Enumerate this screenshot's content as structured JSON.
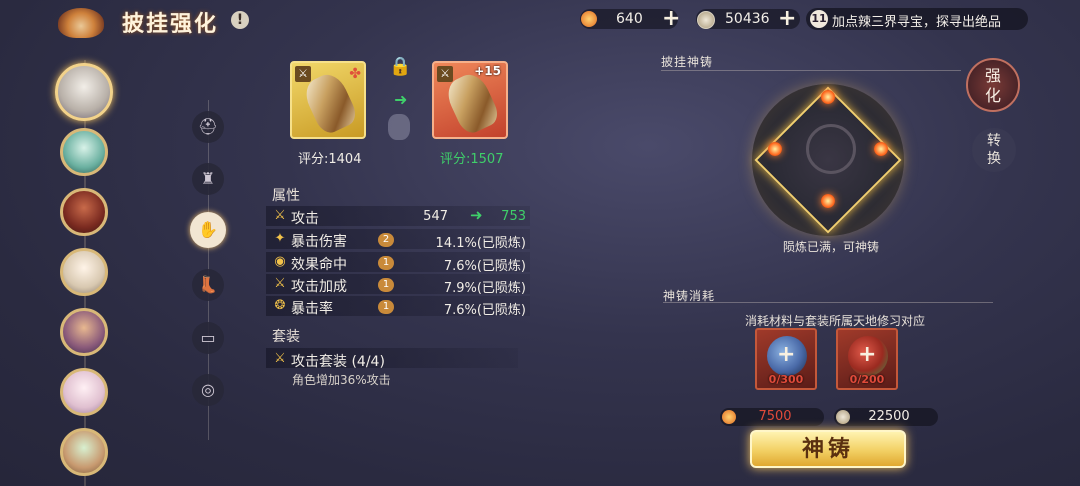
{
  "header": {
    "title": "披挂强化",
    "help_label": "!",
    "resource1": {
      "value": "640",
      "icon": "gold-ingot-icon",
      "plus": "+"
    },
    "resource2": {
      "value": "50436",
      "icon": "coin-icon",
      "plus": "+"
    },
    "hint_badge": "11",
    "hint_text": "加点辣三界寻宝，探寻出绝品"
  },
  "equipment_slots": [
    "helmet-icon",
    "armor-icon",
    "gauntlet-icon",
    "boots-icon",
    "belt-icon",
    "ring-icon"
  ],
  "selected_slot": 2,
  "item": {
    "current_score": "评分:1404",
    "upgraded_score": "评分:1507",
    "upgraded_level": "+15"
  },
  "attributes": {
    "title": "属性",
    "rows": [
      {
        "name": "攻击",
        "from": "547",
        "to": "753",
        "badge": ""
      },
      {
        "name": "暴击伤害",
        "value": "14.1%(已陨炼)",
        "badge": "2"
      },
      {
        "name": "效果命中",
        "value": "7.6%(已陨炼)",
        "badge": "1"
      },
      {
        "name": "攻击加成",
        "value": "7.9%(已陨炼)",
        "badge": "1"
      },
      {
        "name": "暴击率",
        "value": "7.6%(已陨炼)",
        "badge": "1"
      }
    ]
  },
  "set": {
    "title": "套装",
    "name": "攻击套装 (4/4)",
    "effect": "角色增加36%攻击"
  },
  "right_panel": {
    "title": "披挂神铸",
    "tab_strengthen": "强化",
    "tab_convert": "转换",
    "status": "陨炼已满，可神铸",
    "cost_title": "神铸消耗",
    "cost_subtitle": "消耗材料与套装所属天地修习对应",
    "materials": [
      {
        "count": "0/300",
        "color": "#4a6aa8"
      },
      {
        "count": "0/200",
        "color": "#3a8a4a"
      }
    ],
    "cost_gold": "7500",
    "cost_coin": "22500",
    "forge_button": "神铸"
  },
  "colors": {
    "accent_gold": "#f2d064",
    "upgrade_green": "#3fcf6a",
    "insufficient_red": "#e04a3a"
  }
}
